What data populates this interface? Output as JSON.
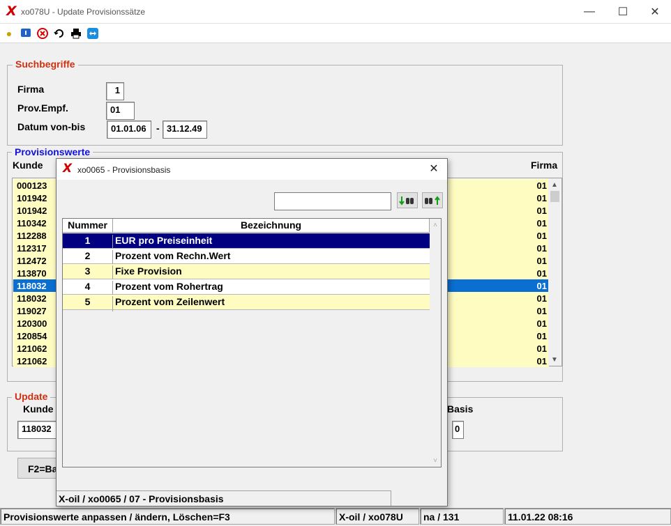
{
  "window": {
    "title": "xo078U - Update Provisionssätze"
  },
  "toolbar": {
    "icons": [
      "lightbulb-icon",
      "info-icon",
      "cancel-icon",
      "refresh-icon",
      "print-icon",
      "teamviewer-icon"
    ]
  },
  "search": {
    "legend": "Suchbegriffe",
    "firma_label": "Firma",
    "firma_value": "1",
    "provempf_label": "Prov.Empf.",
    "provempf_value": "01",
    "datum_label": "Datum von-bis",
    "datum_from": "01.01.06",
    "datum_sep": "-",
    "datum_to": "31.12.49"
  },
  "provisionswerte": {
    "legend": "Provisionswerte",
    "col_kunde": "Kunde",
    "col_firma": "Firma",
    "rows": [
      {
        "kunde": "000123",
        "firma": "01"
      },
      {
        "kunde": "101942",
        "firma": "01"
      },
      {
        "kunde": "101942",
        "firma": "01"
      },
      {
        "kunde": "110342",
        "firma": "01"
      },
      {
        "kunde": "112288",
        "firma": "01"
      },
      {
        "kunde": "112317",
        "firma": "01"
      },
      {
        "kunde": "112472",
        "firma": "01"
      },
      {
        "kunde": "113870",
        "firma": "01"
      },
      {
        "kunde": "118032",
        "firma": "01",
        "selected": true
      },
      {
        "kunde": "118032",
        "firma": "01"
      },
      {
        "kunde": "119027",
        "firma": "01"
      },
      {
        "kunde": "120300",
        "firma": "01"
      },
      {
        "kunde": "120854",
        "firma": "01"
      },
      {
        "kunde": "121062",
        "firma": "01"
      },
      {
        "kunde": "121062",
        "firma": "01"
      }
    ]
  },
  "update": {
    "legend": "Update",
    "kunde_label": "Kunde",
    "kunde_value": "118032",
    "basis_label": "Basis",
    "basis_value": "0"
  },
  "buttons": {
    "f2": "F2=Ba"
  },
  "status": {
    "message": "Provisionswerte anpassen / ändern, Löschen=F3",
    "program": "X-oil / xo078U",
    "record": "na / 131",
    "datetime": "11.01.22 08:16"
  },
  "dialog": {
    "title": "xo0065 - Provisionsbasis",
    "search_value": "",
    "col_nummer": "Nummer",
    "col_bezeichnung": "Bezeichnung",
    "rows": [
      {
        "nummer": "1",
        "bezeichnung": "EUR pro Preiseinheit",
        "selected": true
      },
      {
        "nummer": "2",
        "bezeichnung": "Prozent vom Rechn.Wert"
      },
      {
        "nummer": "3",
        "bezeichnung": "Fixe Provision"
      },
      {
        "nummer": "4",
        "bezeichnung": "Prozent vom Rohertrag"
      },
      {
        "nummer": "5",
        "bezeichnung": "Prozent vom Zeilenwert"
      }
    ],
    "status": "X-oil / xo0065 / 07 - Provisionsbasis"
  },
  "colors": {
    "row_bg": "#fffcc2",
    "row_selected": "#0a6fd0",
    "dialog_selected": "#000080",
    "legend_red": "#d03010",
    "legend_blue": "#1010e0"
  }
}
